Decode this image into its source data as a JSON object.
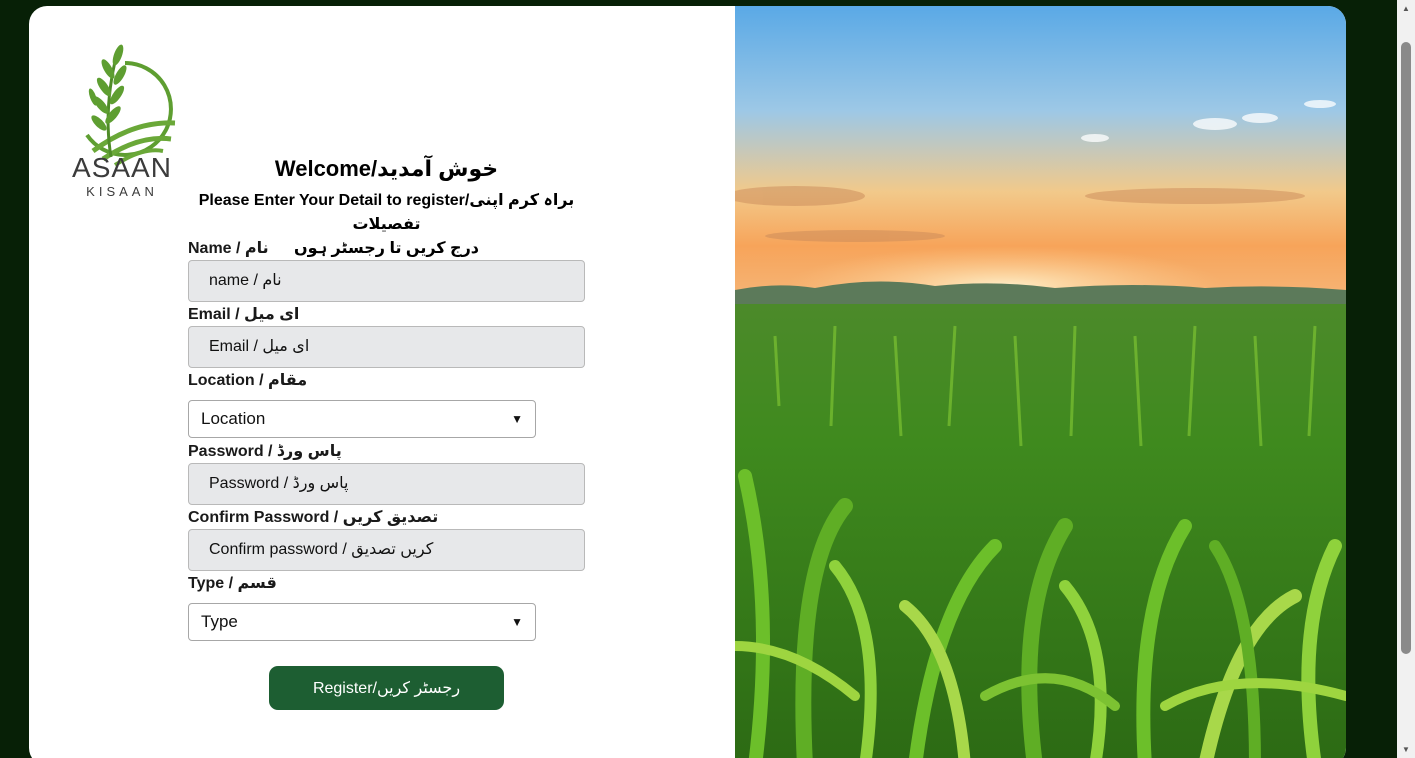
{
  "logo": {
    "word": "ASAAN",
    "sub": "KISAAN"
  },
  "form": {
    "heading": "Welcome/خوش آمدید",
    "subheading_line1": "Please Enter Your Detail to register/براہ کرم اپنی تفصیلات",
    "subheading_line2": "درج کریں تا رجسٹر ہوں",
    "name_label": "Name / نام",
    "name_placeholder": "name / نام",
    "email_label": "Email / ای میل",
    "email_placeholder": "Email / ای میل",
    "location_label": "Location / مقام",
    "location_value": "Location",
    "password_label": "Password / پاس ورڈ",
    "password_placeholder": "Password / پاس ورڈ",
    "confirm_label": "Confirm Password / تصدیق کریں",
    "confirm_placeholder": "Confirm password / کریں تصدیق",
    "type_label": "Type / قسم",
    "type_value": "Type",
    "register_label": "Register/رجسٹر کریں"
  },
  "colors": {
    "brand_green": "#1d5e32",
    "page_bg": "#072006"
  },
  "icons": {
    "select_chevron": "chevron-down-icon"
  }
}
